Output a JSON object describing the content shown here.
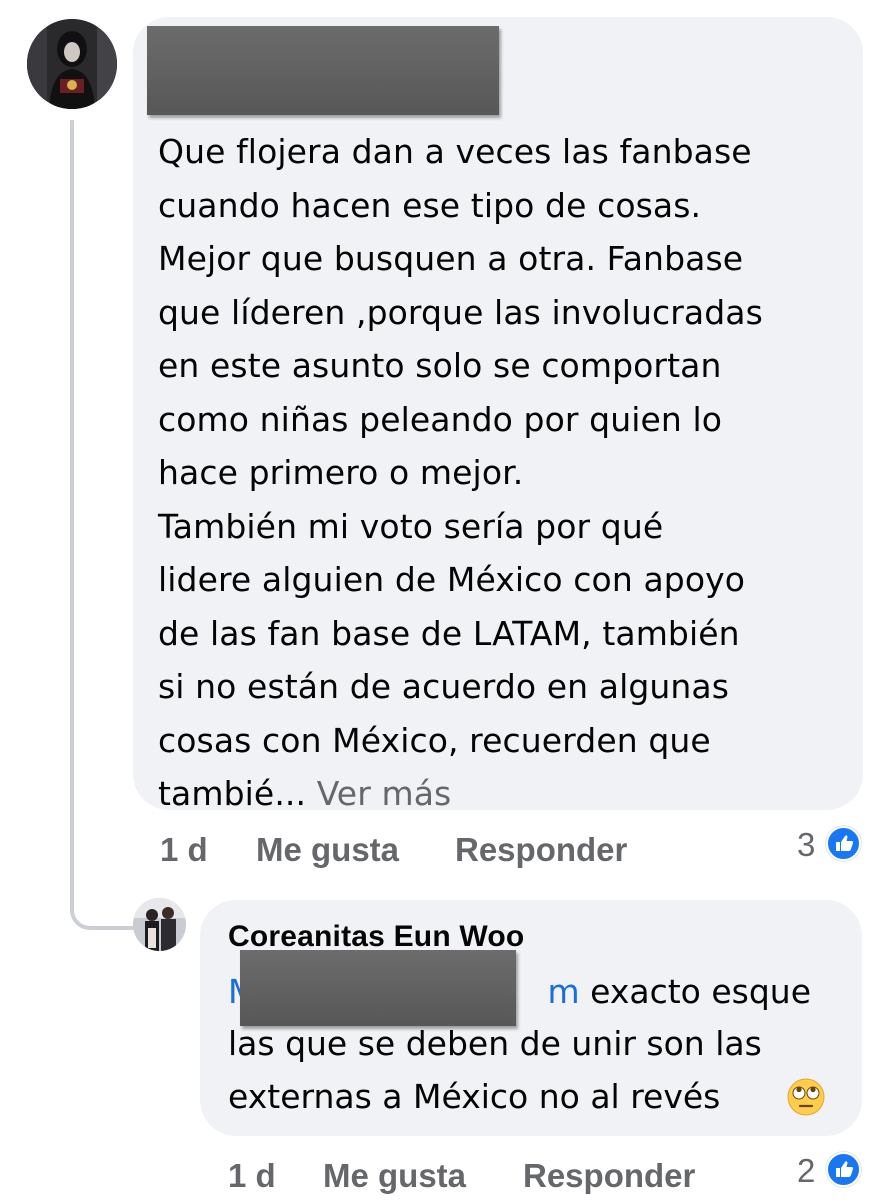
{
  "main_comment": {
    "author_redacted": true,
    "text": "Que flojera dan a veces las fanbase\ncuando hacen ese tipo de cosas.\nMejor que busquen a otra. Fanbase\nque líderen ,porque las involucradas\nen este asunto solo se comportan\ncomo niñas peleando por quien lo\nhace primero o mejor.\nTambién mi voto sería por qué\nlidere alguien de México con apoyo\nde las fan base de LATAM, también\nsi no están de acuerdo en algunas\ncosas con México, recuerden que\ntambié... ",
    "see_more": "Ver más",
    "time": "1 d",
    "like_label": "Me gusta",
    "reply_label": "Responder",
    "reaction_count": "3"
  },
  "reply": {
    "author": "Coreanitas Eun Woo",
    "mention_visible_start": "M",
    "mention_visible_end": "m",
    "line1_rest": " exacto esque",
    "line2": "las que se deben de unir son las",
    "line3": "externas a México no al revés",
    "emoji_icon": "face-with-rolling-eyes",
    "time": "1 d",
    "like_label": "Me gusta",
    "reply_label": "Responder",
    "reaction_count": "2"
  },
  "colors": {
    "bubble": "#f0f2f5",
    "meta_text": "#65676b",
    "link": "#1a6ed8",
    "like_blue": "#1877f2"
  }
}
